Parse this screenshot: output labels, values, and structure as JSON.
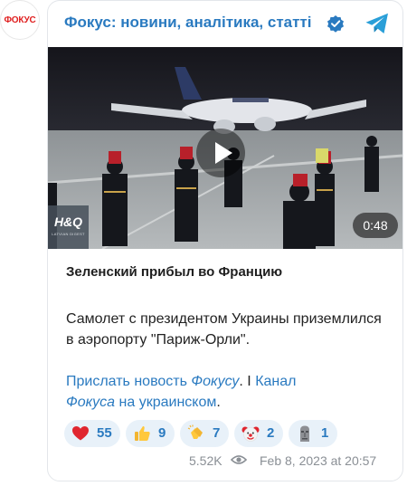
{
  "avatar": {
    "text": "ФОКУС"
  },
  "channel": {
    "title": "Фокус: новини, аналітика, статті",
    "accent": "#2a7ac0"
  },
  "video": {
    "duration": "0:48",
    "logo": "H&Q",
    "logo_sub": "LATVIAN DIGEST"
  },
  "post": {
    "headline": "Зеленский прибыл во Францию",
    "body": "Самолет с президентом Украины приземлился в аэропорту \"Париж-Орли\".",
    "link_send_1": "Прислать новость",
    "link_send_2": "Фокусу",
    "dot": ".",
    "separator": " I ",
    "link_channel_1": "Канал",
    "link_channel_2": "Фокуса",
    "link_channel_3": "на украинском",
    "end_dot": "."
  },
  "reactions": [
    {
      "icon": "heart-icon",
      "count": "55"
    },
    {
      "icon": "thumbs-up-icon",
      "count": "9"
    },
    {
      "icon": "clapping-hands-icon",
      "count": "7"
    },
    {
      "icon": "clown-face-icon",
      "count": "2"
    },
    {
      "icon": "moai-icon",
      "count": "1"
    }
  ],
  "meta": {
    "views": "5.52K",
    "date": "Feb 8, 2023 at 20:57"
  }
}
